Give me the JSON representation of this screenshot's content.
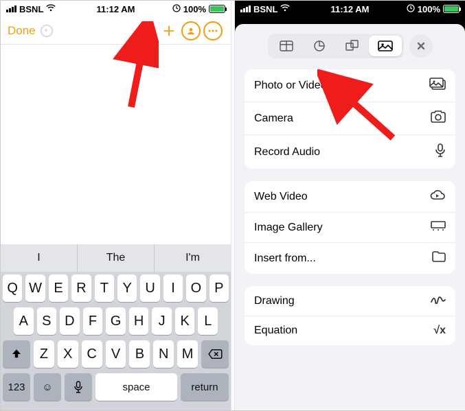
{
  "status": {
    "carrier": "BSNL",
    "time": "11:12 AM",
    "battery_pct": "100%"
  },
  "left": {
    "done": "Done",
    "predictions": [
      "I",
      "The",
      "I'm"
    ],
    "rows": {
      "r1": [
        "Q",
        "W",
        "E",
        "R",
        "T",
        "Y",
        "U",
        "I",
        "O",
        "P"
      ],
      "r2": [
        "A",
        "S",
        "D",
        "F",
        "G",
        "H",
        "J",
        "K",
        "L"
      ],
      "r3": [
        "Z",
        "X",
        "C",
        "V",
        "B",
        "N",
        "M"
      ]
    },
    "fn": {
      "num": "123",
      "space": "space",
      "ret": "return"
    }
  },
  "right": {
    "menu": {
      "section1": [
        {
          "label": "Photo or Video",
          "icon": "photo-video"
        },
        {
          "label": "Camera",
          "icon": "camera"
        },
        {
          "label": "Record Audio",
          "icon": "mic"
        }
      ],
      "section2": [
        {
          "label": "Web Video",
          "icon": "cloud"
        },
        {
          "label": "Image Gallery",
          "icon": "gallery"
        },
        {
          "label": "Insert from...",
          "icon": "folder"
        }
      ],
      "section3": [
        {
          "label": "Drawing",
          "icon": "scribble"
        },
        {
          "label": "Equation",
          "icon": "sqrt"
        }
      ]
    }
  }
}
